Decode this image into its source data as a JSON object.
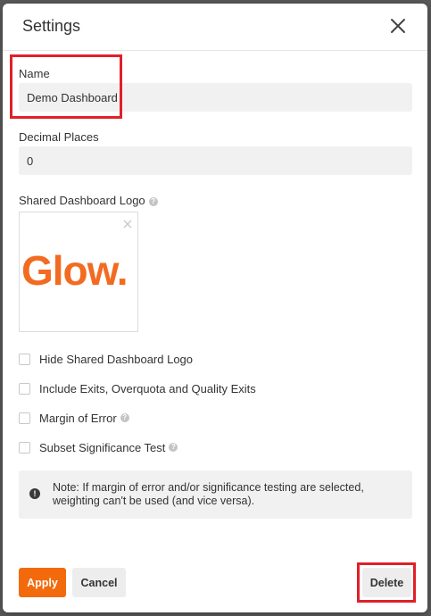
{
  "dialog": {
    "title": "Settings"
  },
  "fields": {
    "name": {
      "label": "Name",
      "value": "Demo Dashboard"
    },
    "decimal_places": {
      "label": "Decimal Places",
      "value": "0"
    },
    "logo": {
      "label": "Shared Dashboard Logo",
      "logo_text": "Glow."
    }
  },
  "options": [
    {
      "label": "Hide Shared Dashboard Logo",
      "checked": false,
      "has_help": false
    },
    {
      "label": "Include Exits, Overquota and Quality Exits",
      "checked": false,
      "has_help": false
    },
    {
      "label": "Margin of Error",
      "checked": false,
      "has_help": true
    },
    {
      "label": "Subset Significance Test",
      "checked": false,
      "has_help": true
    }
  ],
  "note": {
    "text": "Note: If margin of error and/or significance testing are selected, weighting can't be used (and vice versa)."
  },
  "buttons": {
    "apply": "Apply",
    "cancel": "Cancel",
    "delete": "Delete"
  },
  "icons": {
    "help": "?",
    "info": "!"
  },
  "colors": {
    "accent": "#f26a0c",
    "logo": "#f26b21",
    "highlight": "#e0202a"
  }
}
